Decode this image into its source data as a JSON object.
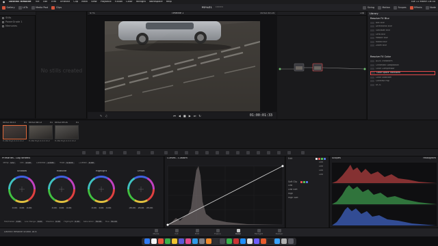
{
  "menubar": {
    "app": "DaVinci Resolve",
    "items": [
      "File",
      "Edit",
      "Trim",
      "Timeline",
      "Clip",
      "Mark",
      "View",
      "Playback",
      "Fusion",
      "Color",
      "Fairlight",
      "Workspace",
      "Help"
    ],
    "clock": "Tue 11 March 16:34"
  },
  "toolbar": {
    "left": [
      "Gallery",
      "LUTs",
      "Media Pool",
      "Clips"
    ],
    "right": [
      "Sizing",
      "Motion",
      "Scopes",
      "Effects",
      "Node"
    ],
    "zoom": "47%",
    "timeline": "Timeline 1",
    "project": "Ночь01",
    "status": "Edited",
    "clip_label": "Clip"
  },
  "gallery": {
    "items": [
      "Stills",
      "PowerGrade 1",
      "Memories"
    ],
    "empty": "No stills created"
  },
  "viewer": {
    "timecode_top": "00:02:30:24",
    "timecode": "01:00:01:33"
  },
  "library": {
    "tab": "Library",
    "section1": "Resolve FX Blur",
    "blur_items": [
      "Box Blur",
      "Directional Blur",
      "Gaussian Blur",
      "Lens Blur",
      "Mosaic Blur",
      "Radial Blur",
      "Zoom Blur"
    ],
    "section2": "Resolve FX Color",
    "color_items": [
      "ACES Transform",
      "Chromatic Adaptation",
      "Color Compressor",
      "Color Space Transform",
      "Color Stabilizer",
      "Contrast Pop",
      "DCTL"
    ],
    "selected": "Color Space Transform"
  },
  "clips": [
    {
      "tc": "00:02:30:07",
      "v": "V1",
      "label": "H.264 High 4:2:2 L5.2",
      "sel": true
    },
    {
      "tc": "00:02:58:13",
      "v": "V1",
      "label": "H.264 High 4:2:2 L5.2",
      "sel": false
    },
    {
      "tc": "00:02:59:20",
      "v": "V1",
      "label": "H.264 High 4:2:2 L5.2",
      "sel": false
    }
  ],
  "primaries": {
    "title": "Primaries - Log Wheels",
    "row1": [
      [
        "Temp",
        "0.0"
      ],
      [
        "Tint",
        "0.00"
      ],
      [
        "Contrast",
        "1.000"
      ],
      [
        "Pivot",
        "0.435"
      ],
      [
        "L.Detail",
        "0.00"
      ]
    ],
    "wheels": [
      {
        "name": "Shadow",
        "vals": [
          "0.00",
          "0.00",
          "0.00"
        ]
      },
      {
        "name": "Midtone",
        "vals": [
          "0.00",
          "0.00",
          "0.00"
        ]
      },
      {
        "name": "Highlight",
        "vals": [
          "0.00",
          "0.00",
          "0.00"
        ]
      },
      {
        "name": "Offset",
        "vals": [
          "25.00",
          "25.00",
          "25.00"
        ]
      }
    ],
    "row2": [
      [
        "Mid/Detail",
        "0.00"
      ],
      [
        "Low Range",
        "0.00"
      ],
      [
        "Shadow",
        "0.00"
      ],
      [
        "Highlight",
        "0.00"
      ],
      [
        "Saturation",
        "50.00"
      ],
      [
        "Hue",
        "50.00"
      ]
    ]
  },
  "curves": {
    "title": "Curves - Custom",
    "edit": "Edit",
    "soft_clip": "Soft Clip",
    "cs": [
      [
        "Low",
        ""
      ],
      [
        "Low Soft",
        ""
      ],
      [
        "High",
        ""
      ],
      [
        "High Soft",
        ""
      ]
    ],
    "vals": [
      "100",
      "100",
      "100",
      "100"
    ]
  },
  "scopes": {
    "title": "Scopes",
    "mode": "Histogram"
  },
  "pages": [
    "Media",
    "Cut",
    "Edit",
    "Fusion",
    "Color",
    "Fairlight",
    "Deliver"
  ],
  "active_page": "Color",
  "footer": "DaVinci Resolve Studio 18.6",
  "colors": {
    "accent": "#e26a3b",
    "select_red": "#e44a4a"
  }
}
